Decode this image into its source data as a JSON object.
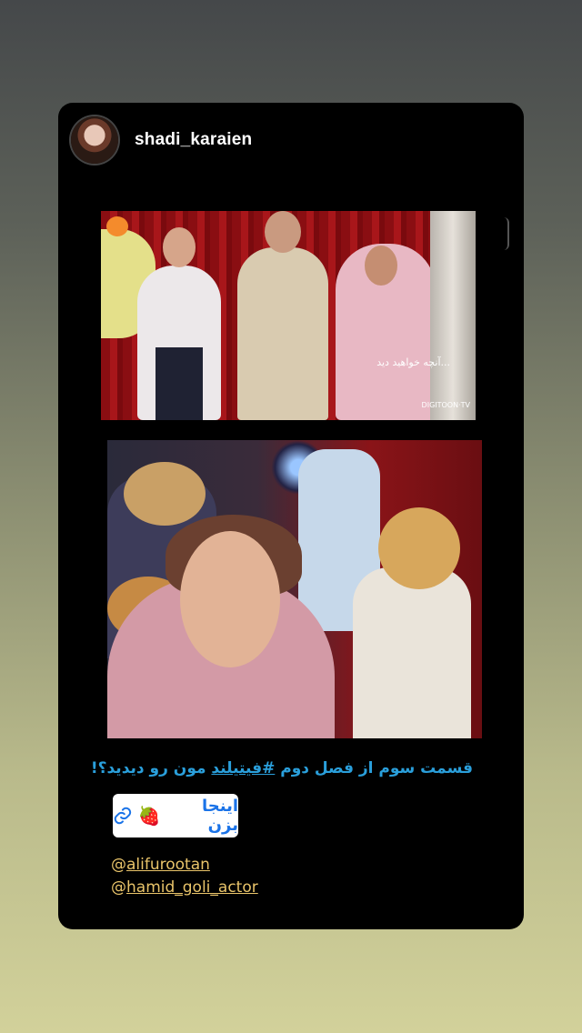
{
  "story": {
    "username": "shadi_karaien"
  },
  "photo1": {
    "overlay_caption": "آنچه خواهید دید...",
    "brand": "DIGITOON·TV"
  },
  "caption": {
    "prefix": "قسمت سوم از فصل دوم ",
    "hashtag": "#فیتیلند",
    "suffix": " مون رو دیدید؟!"
  },
  "link_sticker": {
    "label": "اینجا بزن",
    "emoji": "🍓",
    "icon": "link-icon"
  },
  "mentions": [
    {
      "at": "@",
      "handle": "alifurootan"
    },
    {
      "at": "@",
      "handle": "hamid_goli_actor"
    }
  ],
  "colors": {
    "caption": "#2a9fdb",
    "mention": "#e9c46a",
    "link": "#1a73e8"
  }
}
